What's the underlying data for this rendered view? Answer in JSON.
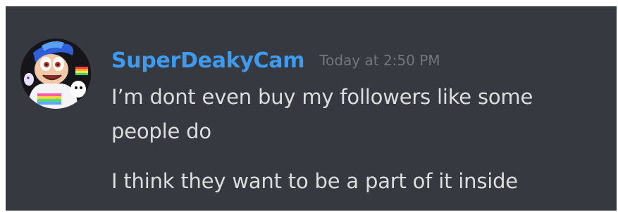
{
  "message": {
    "author": "SuperDeakyCam",
    "timestamp": "Today at 2:50 PM",
    "lines": [
      "I’m dont even buy my followers like some people do",
      "I think they want to be a part of it inside"
    ]
  },
  "colors": {
    "background": "#36393f",
    "username": "#3d9cf2",
    "timestamp": "#72767d",
    "text": "#dcddde"
  },
  "icons": {
    "avatar": "cartoon-character-avatar"
  }
}
